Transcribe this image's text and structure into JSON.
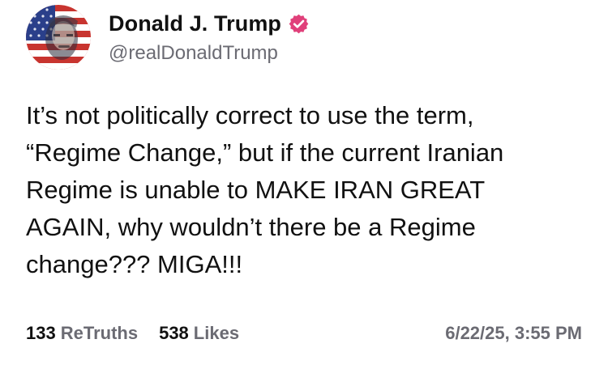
{
  "account": {
    "display_name": "Donald J. Trump",
    "handle": "@realDonaldTrump",
    "avatar_icon": "avatar-flag-portrait",
    "verified_icon": "verified-badge-icon",
    "verified_color": "#e0407a"
  },
  "post": {
    "text": "It’s not politically correct to use the term,\n“Regime Change,” but if the current Iranian\nRegime is unable to MAKE IRAN GREAT\nAGAIN, why wouldn’t there be a Regime\nchange??? MIGA!!!"
  },
  "stats": {
    "retruths_count": "133",
    "retruths_label": "ReTruths",
    "likes_count": "538",
    "likes_label": "Likes",
    "timestamp": "6/22/25, 3:55 PM"
  }
}
